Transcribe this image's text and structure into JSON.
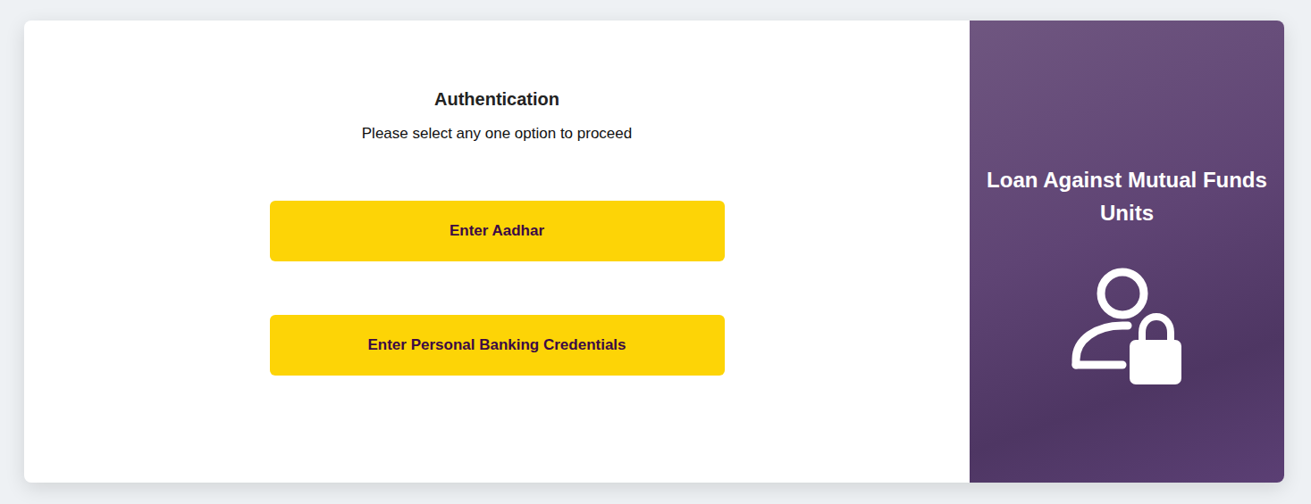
{
  "auth": {
    "title": "Authentication",
    "subtitle": "Please select any one option to proceed",
    "options": [
      "Enter Aadhar",
      "Enter Personal Banking Credentials"
    ]
  },
  "side_panel": {
    "title": "Loan Against Mutual Funds Units"
  }
}
